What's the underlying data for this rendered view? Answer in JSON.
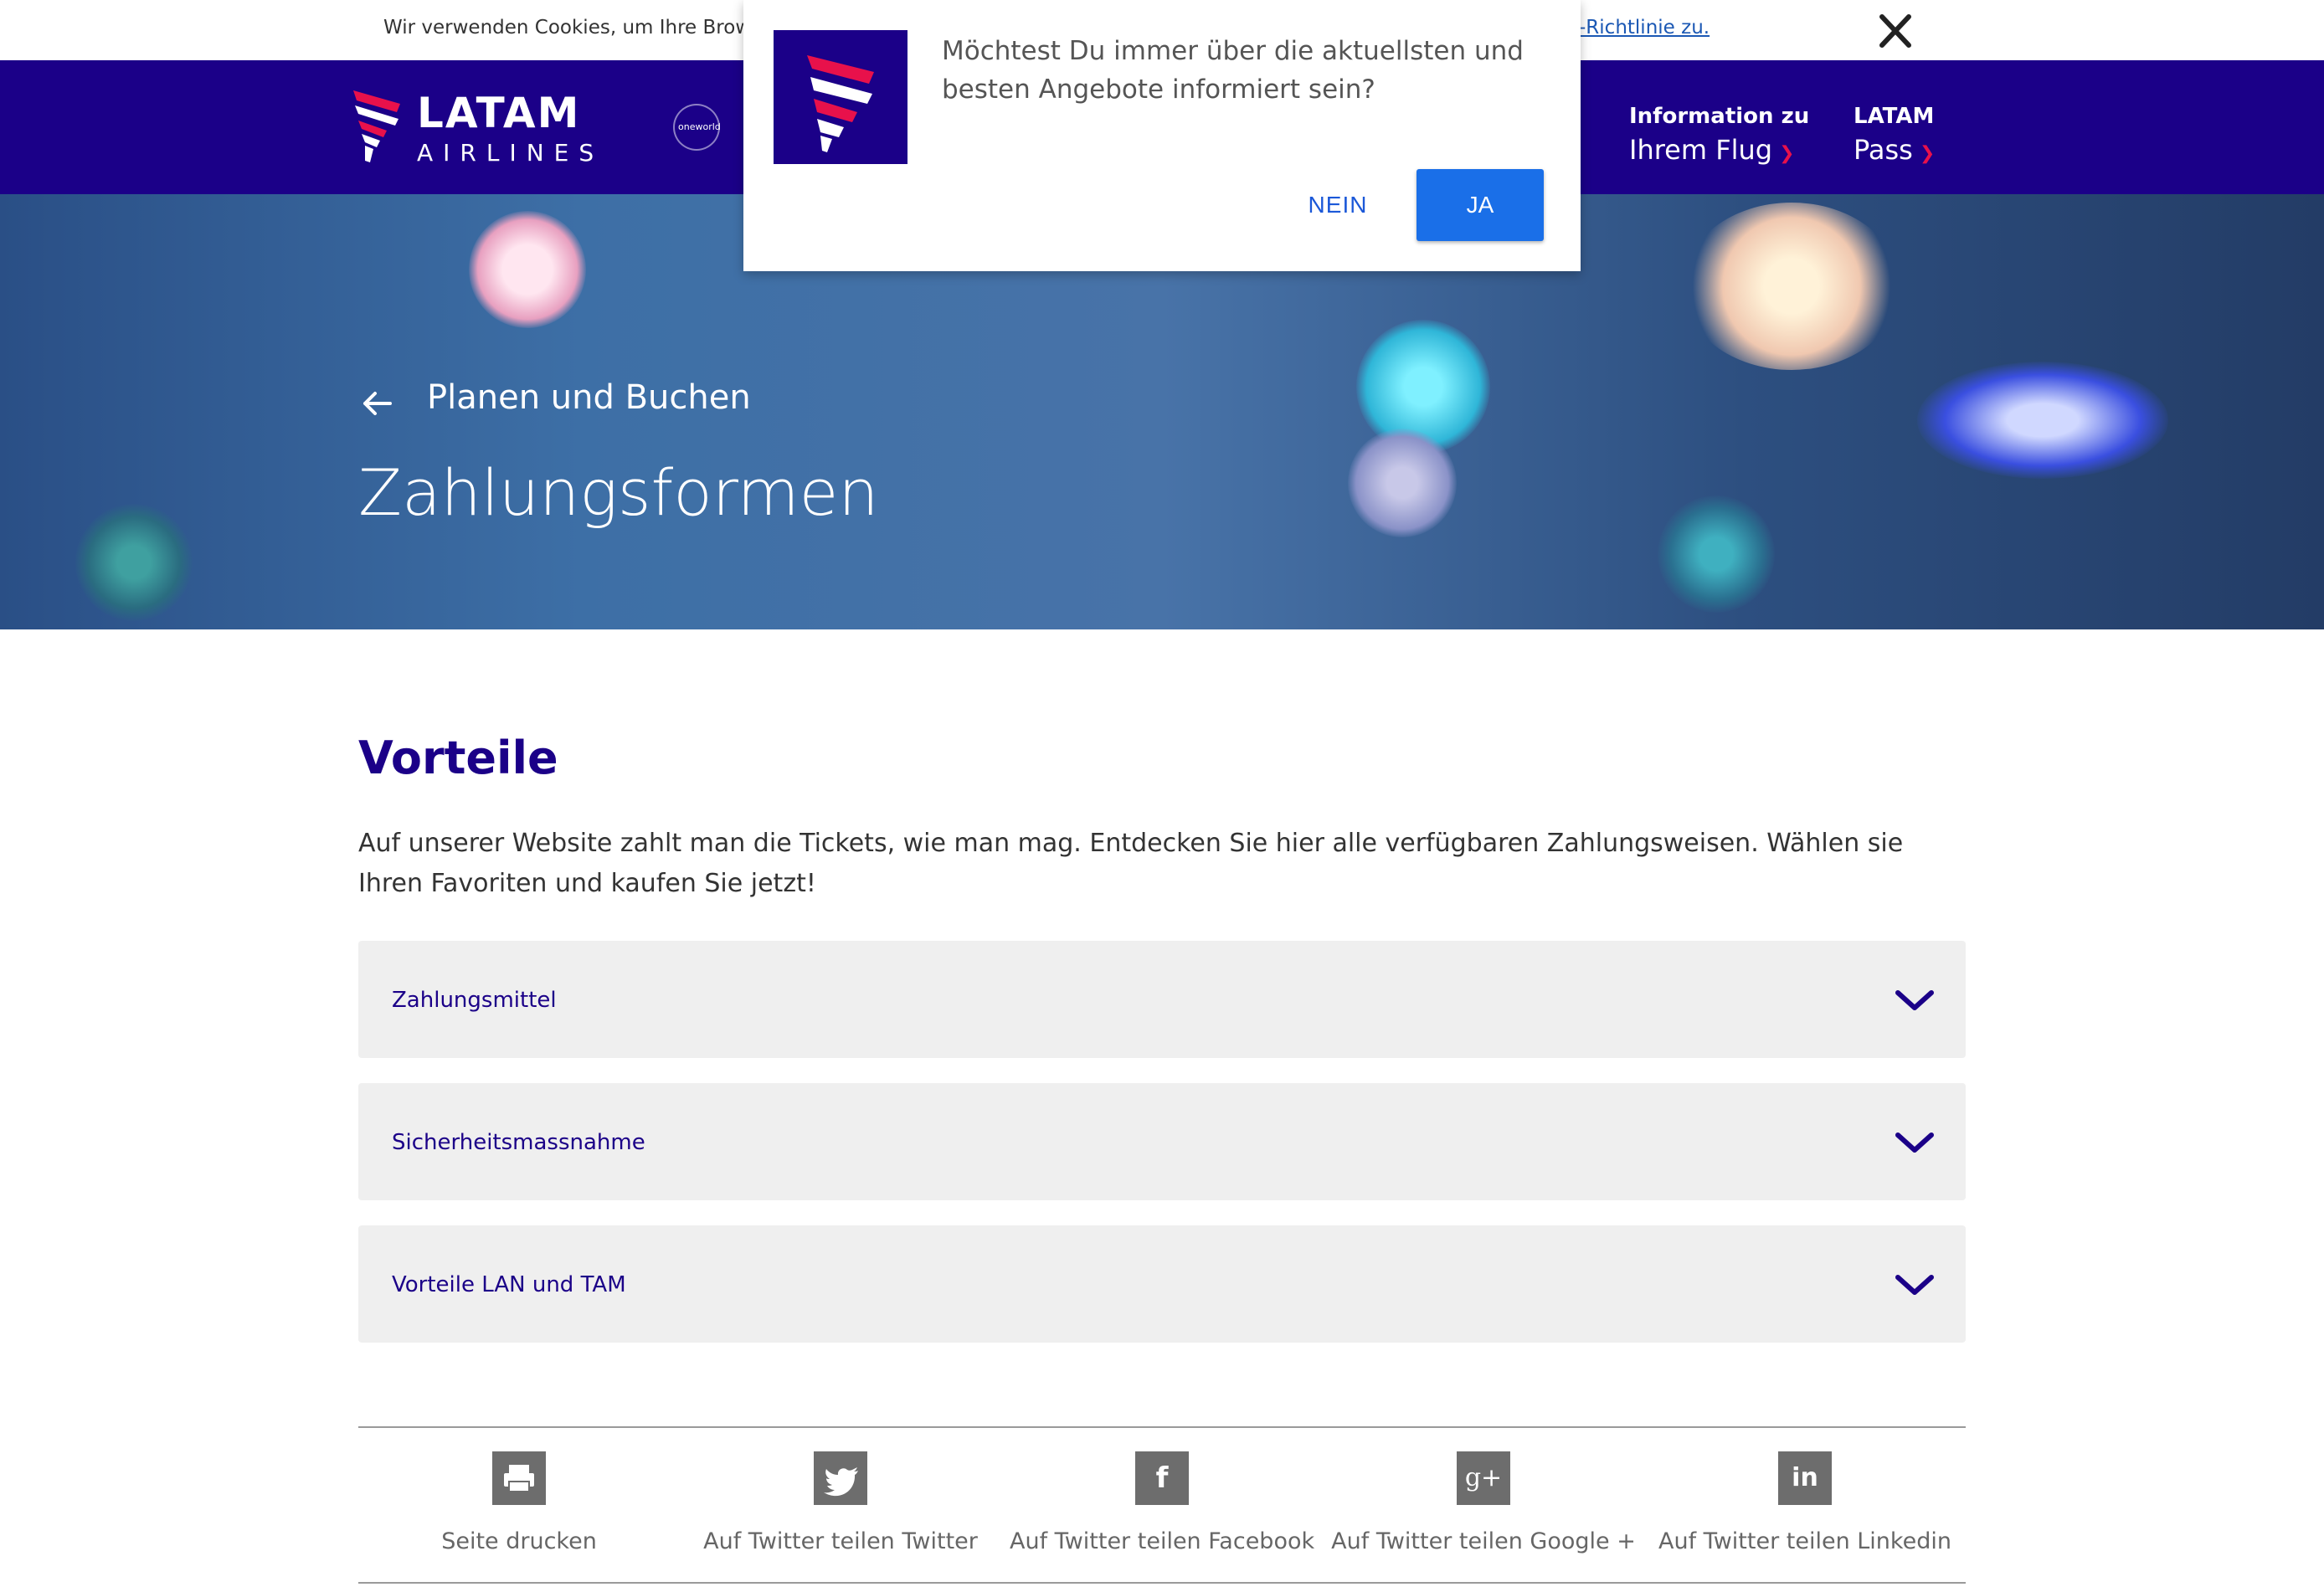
{
  "cookie": {
    "text": "Wir verwenden Cookies, um Ihre Browser-",
    "link": "-Richtlinie zu."
  },
  "header": {
    "logo_word": "LATAM",
    "logo_sub": "AIRLINES",
    "alliance": "oneworld",
    "nav": [
      {
        "line1": "Information zu",
        "line2": "Ihrem Flug"
      },
      {
        "line1": "LATAM",
        "line2": "Pass"
      }
    ]
  },
  "hero": {
    "back_label": "Planen und Buchen",
    "title": "Zahlungsformen"
  },
  "main": {
    "section_title": "Vorteile",
    "intro": "Auf unserer Website zahlt man die Tickets, wie man mag. Entdecken Sie hier alle verfügbaren Zahlungsweisen. Wählen sie Ihren Favoriten und kaufen Sie jetzt!",
    "accordion": [
      {
        "label": "Zahlungsmittel"
      },
      {
        "label": "Sicherheitsmassnahme"
      },
      {
        "label": "Vorteile LAN und TAM"
      }
    ]
  },
  "share": [
    {
      "label": "Seite drucken",
      "icon": "print-icon"
    },
    {
      "label": "Auf Twitter teilen Twitter",
      "icon": "twitter-icon"
    },
    {
      "label": "Auf Twitter teilen Facebook",
      "icon": "facebook-icon"
    },
    {
      "label": "Auf Twitter teilen Google +",
      "icon": "google-plus-icon"
    },
    {
      "label": "Auf Twitter teilen Linkedin",
      "icon": "linkedin-icon"
    }
  ],
  "modal": {
    "text": "Möchtest Du immer über die aktuellsten und besten Angebote informiert sein?",
    "no_label": "NEIN",
    "yes_label": "JA"
  },
  "colors": {
    "brand": "#1b0088",
    "accent": "#e8114b",
    "button": "#1a6fe8"
  }
}
